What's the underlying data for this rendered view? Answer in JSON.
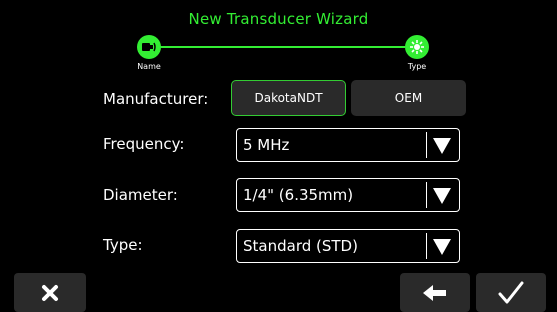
{
  "wizard": {
    "title": "New Transducer Wizard",
    "steps": [
      {
        "label": "Name",
        "icon": "transducer-probe-icon"
      },
      {
        "label": "Type",
        "icon": "crystal-element-icon"
      }
    ]
  },
  "form": {
    "manufacturer": {
      "label": "Manufacturer:",
      "options": [
        "DakotaNDT",
        "OEM"
      ],
      "selected": "DakotaNDT"
    },
    "frequency": {
      "label": "Frequency:",
      "value": "5 MHz"
    },
    "diameter": {
      "label": "Diameter:",
      "value": "1/4\" (6.35mm)"
    },
    "type": {
      "label": "Type:",
      "value": "Standard (STD)"
    }
  },
  "toolbar": {
    "cancel_icon": "close-icon",
    "back_icon": "back-arrow-icon",
    "confirm_icon": "checkmark-icon"
  },
  "colors": {
    "accent": "#33ee33",
    "button_bg": "#2a2a2a",
    "background": "#000000"
  }
}
